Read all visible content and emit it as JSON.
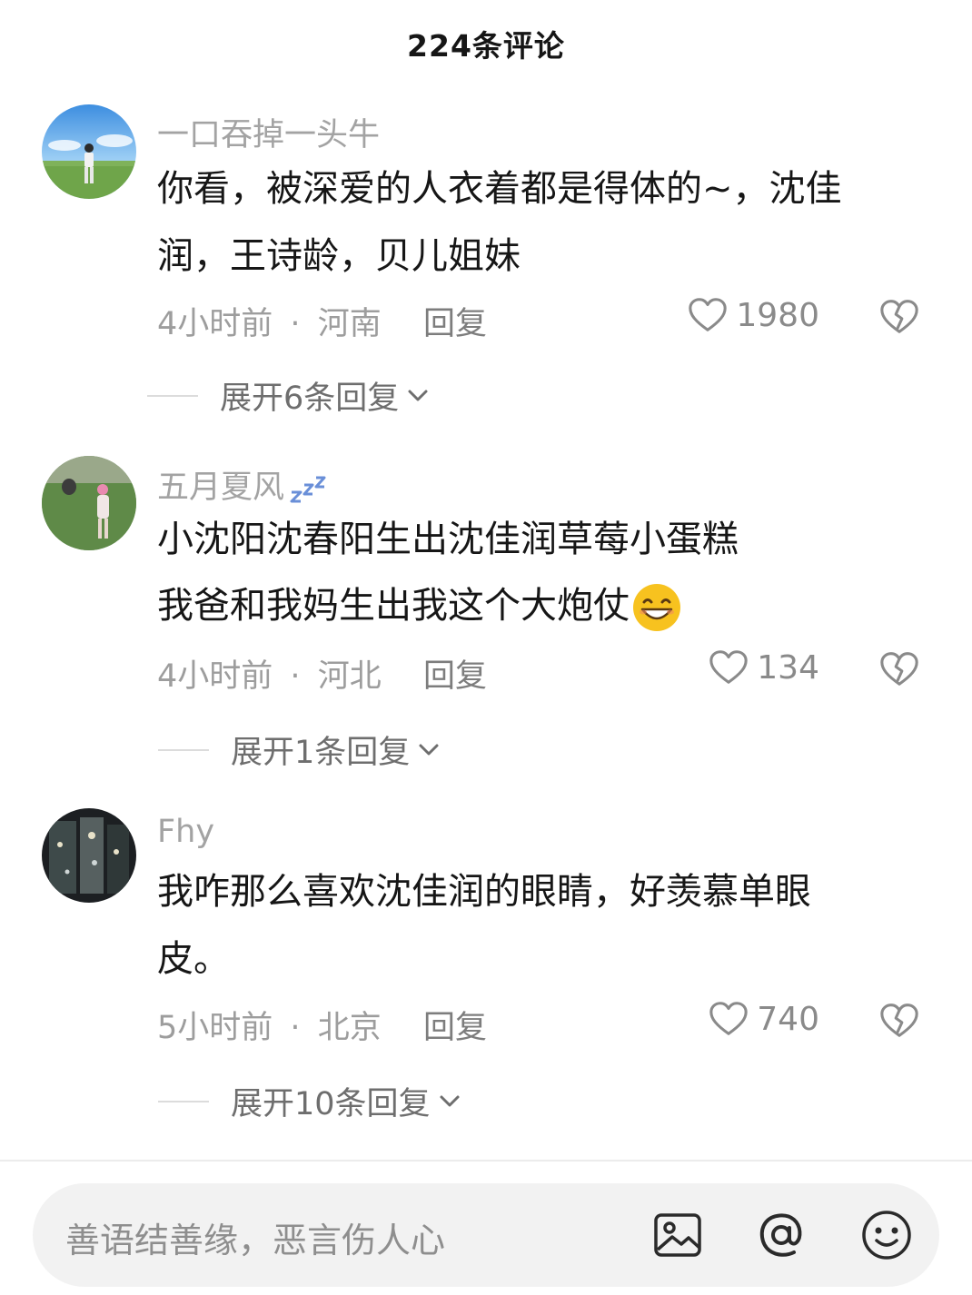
{
  "header": {
    "title": "224条评论"
  },
  "comments": [
    {
      "username": "一口吞掉一头牛",
      "lines": [
        "你看，被深爱的人衣着都是得体的~，沈佳",
        "润，王诗龄，贝儿姐妹"
      ],
      "time": "4小时前",
      "location": "河南",
      "reply_label": "回复",
      "likes": "1980",
      "expand_label": "展开6条回复"
    },
    {
      "username": "五月夏风",
      "lines": [
        "小沈阳沈春阳生出沈佳润草莓小蛋糕",
        "我爸和我妈生出我这个大炮仗"
      ],
      "time": "4小时前",
      "location": "河北",
      "reply_label": "回复",
      "likes": "134",
      "expand_label": "展开1条回复"
    },
    {
      "username": "Fhy",
      "lines": [
        "我咋那么喜欢沈佳润的眼睛，好羡慕单眼",
        "皮。"
      ],
      "time": "5小时前",
      "location": "北京",
      "reply_label": "回复",
      "likes": "740",
      "expand_label": "展开10条回复"
    }
  ],
  "meta_separator": "·",
  "input": {
    "placeholder": "善语结善缘，恶言伤人心"
  },
  "icons": {
    "like": "heart-outline-icon",
    "dislike": "broken-heart-icon",
    "expand": "chevron-down-icon",
    "image": "image-icon",
    "mention": "at-icon",
    "emoji": "smiley-icon",
    "zzz": "sleeping-zzz-icon",
    "grin": "grinning-emoji-icon"
  },
  "colors": {
    "text": "#161616",
    "muted": "#9d9d9d",
    "accent_blue": "#6a8fd8"
  }
}
